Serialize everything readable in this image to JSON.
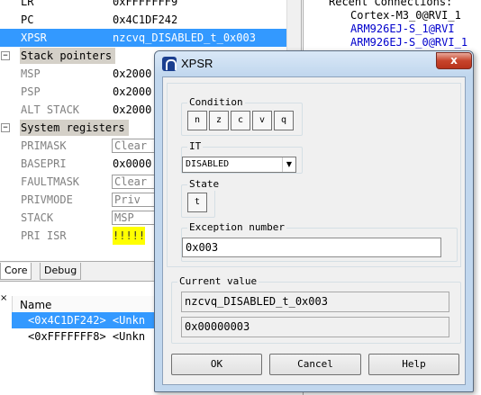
{
  "registers": {
    "rows_top": [
      {
        "name": "LR",
        "value": "0xFFFFFFF9",
        "style": "plain"
      },
      {
        "name": "PC",
        "value": "0x4C1DF242",
        "style": "plain"
      },
      {
        "name": "XPSR",
        "value": "nzcvq_DISABLED_t_0x003",
        "style": "selected"
      }
    ],
    "stack_group": {
      "label": "Stack pointers",
      "toggle": "−"
    },
    "stack_rows": [
      {
        "name": "MSP",
        "value": "0x2000"
      },
      {
        "name": "PSP",
        "value": "0x2000"
      },
      {
        "name": "ALT STACK",
        "value": "0x2000"
      }
    ],
    "system_group": {
      "label": "System registers",
      "toggle": "−"
    },
    "system_rows": {
      "primask": {
        "name": "PRIMASK",
        "value": "Clear"
      },
      "basepri": {
        "name": "BASEPRI",
        "value": "0x0000"
      },
      "faultmask": {
        "name": "FAULTMASK",
        "value": "Clear"
      },
      "privmode": {
        "name": "PRIVMODE",
        "value": "Priv"
      },
      "stack": {
        "name": "STACK",
        "value": "MSP"
      },
      "pri_isr": {
        "name": "PRI ISR",
        "value": "!!!!!"
      }
    }
  },
  "tabs": {
    "core": "Core",
    "debug": "Debug"
  },
  "callstack": {
    "close": "×",
    "header": "Name",
    "rows": [
      "<0x4C1DF242> <Unkn",
      "<0xFFFFFFF8> <Unkn"
    ]
  },
  "connections": {
    "title": "Recent Connections:",
    "items": [
      "Cortex-M3_0@RVI_1",
      "ARM926EJ-S_1@RVI",
      "ARM926EJ-S_0@RVI_1"
    ]
  },
  "dialog": {
    "title": "XPSR",
    "close_label": "x",
    "condition": {
      "label": "Condition",
      "flags": [
        "n",
        "z",
        "c",
        "v",
        "q"
      ]
    },
    "it": {
      "label": "IT",
      "selected": "DISABLED"
    },
    "state": {
      "label": "State",
      "flag": "t"
    },
    "exception": {
      "label": "Exception number",
      "value": "0x003"
    },
    "current": {
      "label": "Current value",
      "symbolic": "nzcvq_DISABLED_t_0x003",
      "hex": "0x00000003"
    },
    "buttons": {
      "ok": "OK",
      "cancel": "Cancel",
      "help": "Help"
    }
  },
  "colors": {
    "selection": "#3399ff",
    "highlight": "#ffff00",
    "link": "#0000cc",
    "close_button": "#c7442c"
  }
}
